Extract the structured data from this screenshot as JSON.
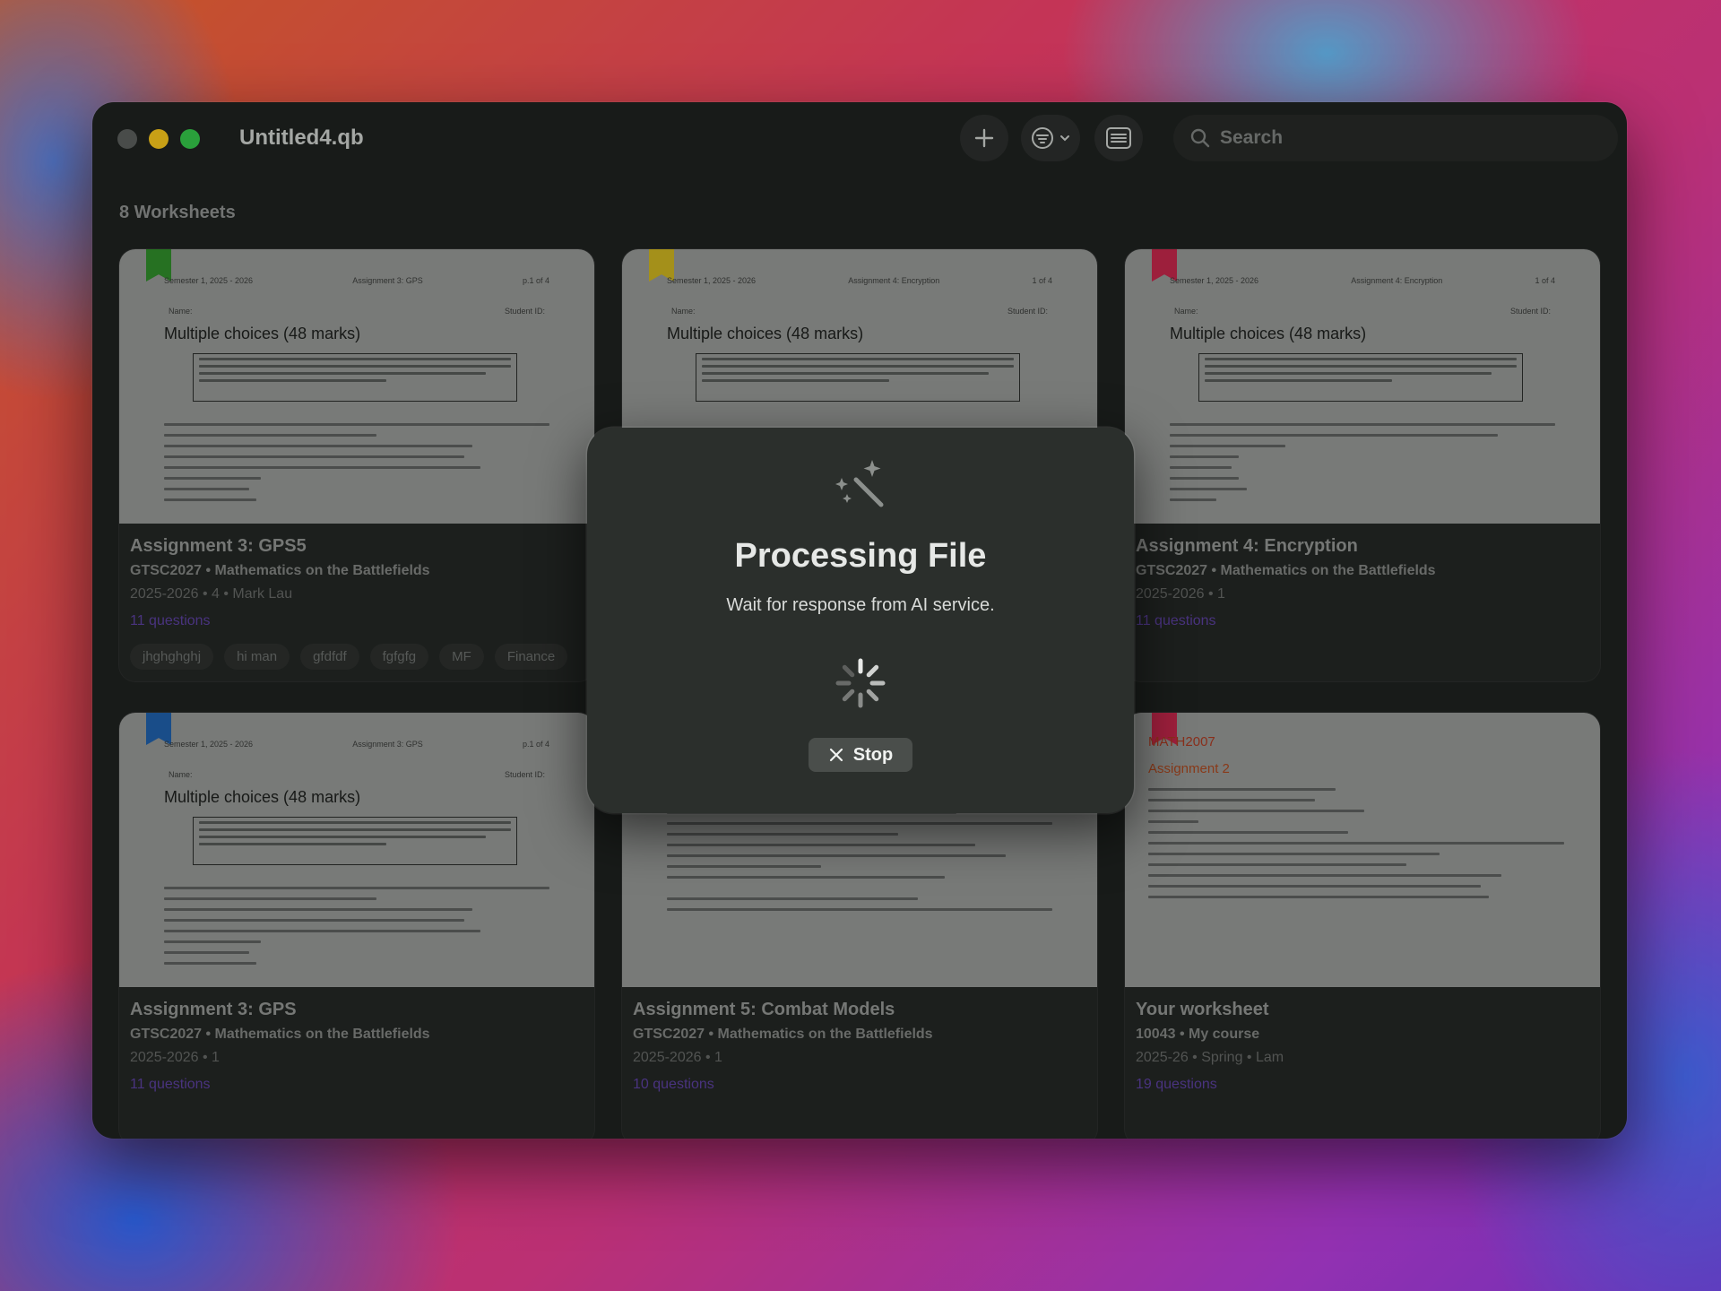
{
  "window": {
    "title": "Untitled4.qb"
  },
  "toolbar": {
    "search_placeholder": "Search"
  },
  "worksheets_count": "8 Worksheets",
  "cards": [
    {
      "ribbon_color": "#2f8a2a",
      "thumb": {
        "header_left": "Semester 1, 2025 - 2026",
        "header_mid": "Assignment 3: GPS",
        "header_right": "p.1 of 4",
        "name_left": "Name:",
        "name_right": "Student ID:",
        "title": "Multiple choices (48 marks)"
      },
      "title": "Assignment 3: GPS5",
      "subtitle": "GTSC2027 • Mathematics on the Battlefields",
      "meta": "2025-2026 • 4 • Mark Lau",
      "questions": "11 questions",
      "tags": [
        "jhghghghj",
        "hi man",
        "gfdfdf",
        "fgfgfg",
        "MF",
        "Finance"
      ]
    },
    {
      "ribbon_color": "#c8b020",
      "thumb": {
        "header_left": "Semester 1, 2025 - 2026",
        "header_mid": "Assignment 4: Encryption",
        "header_right": "1 of 4",
        "name_left": "Name:",
        "name_right": "Student ID:",
        "title": "Multiple choices (48 marks)"
      },
      "title": "",
      "subtitle": "",
      "meta": "",
      "questions": "",
      "tags": []
    },
    {
      "ribbon_color": "#c0264a",
      "thumb": {
        "header_left": "Semester 1, 2025 - 2026",
        "header_mid": "Assignment 4: Encryption",
        "header_right": "1 of 4",
        "name_left": "Name:",
        "name_right": "Student ID:",
        "title": "Multiple choices (48 marks)"
      },
      "title": "Assignment 4: Encryption",
      "subtitle": "GTSC2027 • Mathematics on the Battlefields",
      "meta": "2025-2026 • 1",
      "questions": "11 questions",
      "tags": []
    },
    {
      "ribbon_color": "#1f5fa8",
      "thumb": {
        "header_left": "Semester 1, 2025 - 2026",
        "header_mid": "Assignment 3: GPS",
        "header_right": "p.1 of 4",
        "name_left": "Name:",
        "name_right": "Student ID:",
        "title": "Multiple choices (48 marks)"
      },
      "title": "Assignment 3: GPS",
      "subtitle": "GTSC2027 • Mathematics on the Battlefields",
      "meta": "2025-2026 • 1",
      "questions": "11 questions",
      "tags": []
    },
    {
      "ribbon_color": "",
      "thumb": {
        "header_left": "",
        "header_mid": "",
        "header_right": "",
        "name_left": "",
        "name_right": "",
        "title": ""
      },
      "title": "Assignment 5: Combat Models",
      "subtitle": "GTSC2027 • Mathematics on the Battlefields",
      "meta": "2025-2026 • 1",
      "questions": "10 questions",
      "tags": []
    },
    {
      "ribbon_color": "#c0264a",
      "thumb": {
        "math_head": "MATH2007",
        "math_sub": "Assignment 2"
      },
      "title": "Your worksheet",
      "subtitle": "10043 • My course",
      "meta": "2025-26 • Spring • Lam",
      "questions": "19 questions",
      "tags": []
    }
  ],
  "modal": {
    "title": "Processing File",
    "description": "Wait for response from AI service.",
    "stop_label": "Stop"
  }
}
